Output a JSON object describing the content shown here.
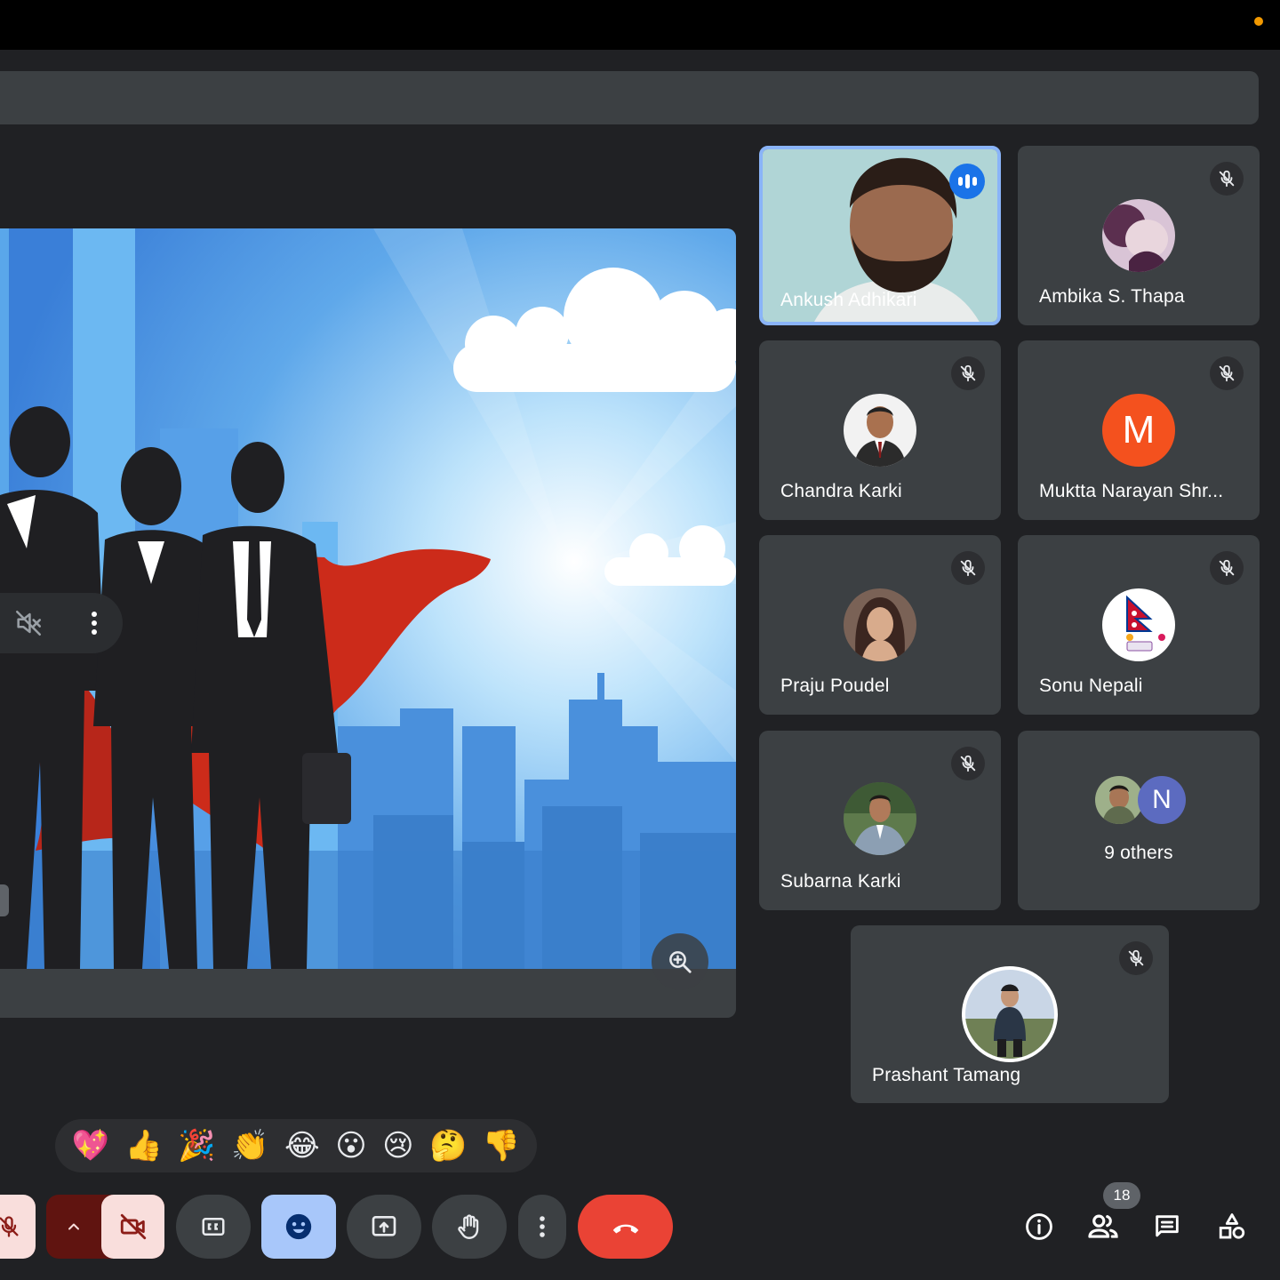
{
  "meeting": {
    "participant_count": "18"
  },
  "participants": [
    {
      "name": "Ankush Adhikari",
      "speaking": true
    },
    {
      "name": "Ambika S. Thapa"
    },
    {
      "name": "Chandra Karki"
    },
    {
      "name": "Muktta Narayan Shr...",
      "initial": "M",
      "avatar_color": "#f4511e"
    },
    {
      "name": "Praju Poudel"
    },
    {
      "name": "Sonu Nepali"
    },
    {
      "name": "Subarna Karki"
    },
    {
      "name": "9 others",
      "initial": "N",
      "avatar_color": "#5c6bc0"
    },
    {
      "name": "Prashant Tamang"
    }
  ],
  "reactions": [
    "💖",
    "👍",
    "🎉",
    "👏",
    "😂",
    "😮",
    "😢",
    "🤔",
    "👎"
  ],
  "icons": {
    "mic": "mic-off-icon",
    "camera": "camera-off-icon",
    "captions": "captions-icon",
    "emoji": "emoji-icon",
    "present": "present-icon",
    "hand": "raise-hand-icon",
    "more": "more-options-icon",
    "leave": "leave-call-icon",
    "info": "info-icon",
    "people": "people-icon",
    "chat": "chat-icon",
    "activities": "activities-icon"
  },
  "colors": {
    "leave": "#ea4335",
    "reactions_active": "#a8c7fa",
    "camera_off": "#f9dedc",
    "speaking_border": "#8ab4f8"
  }
}
